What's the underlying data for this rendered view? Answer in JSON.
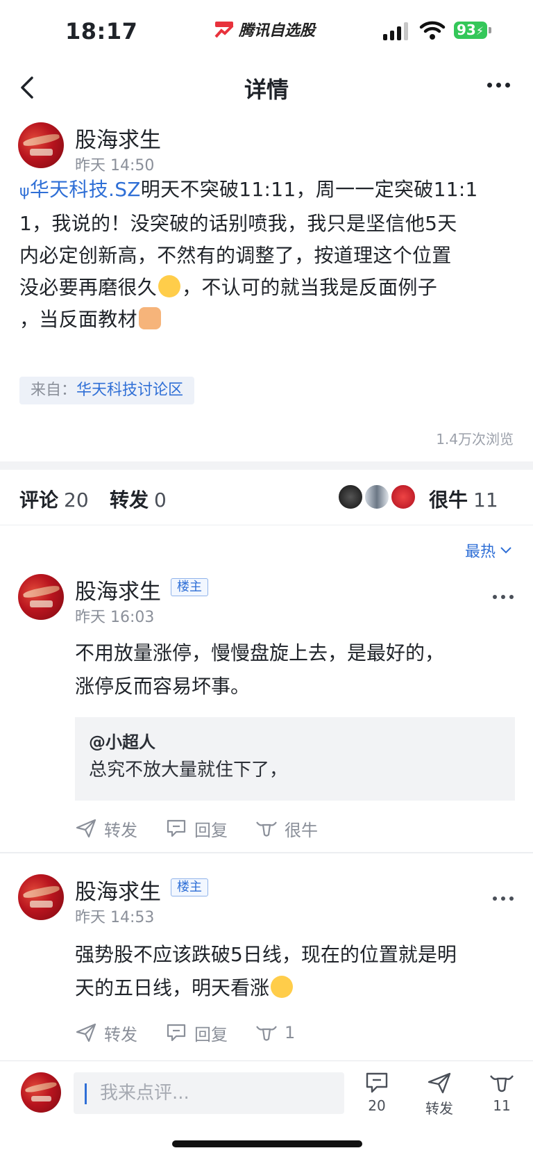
{
  "status_bar": {
    "time": "18:17",
    "app": "腾讯自选股",
    "battery": "93"
  },
  "nav": {
    "title": "详情"
  },
  "post": {
    "author": "股海求生",
    "time": "昨天 14:50",
    "stock": "华天科技.SZ",
    "line1": "明天不突破11:11，周一一定突破11:1",
    "line2": "1，我说的！没突破的话别喷我，我只是坚信他5天",
    "line3": "内必定创新高，不然有的调整了，按道理这个位置",
    "line4a": "没必要再磨很久",
    "line4b": "，不认可的就当我是反面例子",
    "line5": "，当反面教材",
    "source_prefix": "来自：",
    "source_name": "华天科技讨论区",
    "views": "1.4万次浏览"
  },
  "stats": {
    "comment_label": "评论",
    "comment_count": "20",
    "repost_label": "转发",
    "repost_count": "0",
    "like_label": "很牛",
    "like_count": "11"
  },
  "sort": {
    "label": "最热"
  },
  "comments": [
    {
      "author": "股海求生",
      "tag": "楼主",
      "time": "昨天 16:03",
      "line1": "不用放量涨停，慢慢盘旋上去，是最好的，",
      "line2": "涨停反而容易坏事。",
      "quote_user": "@小超人",
      "quote_text": "总究不放大量就住下了，",
      "repost": "转发",
      "reply": "回复",
      "like": "很牛"
    },
    {
      "author": "股海求生",
      "tag": "楼主",
      "time": "昨天 14:53",
      "line1": "强势股不应该跌破5日线，现在的位置就是明",
      "line2": "天的五日线，明天看涨",
      "repost": "转发",
      "reply": "回复",
      "like": "1"
    }
  ],
  "bottom_bar": {
    "input_placeholder": "我来点评...",
    "comment_count": "20",
    "repost_label": "转发",
    "like_count": "11"
  }
}
